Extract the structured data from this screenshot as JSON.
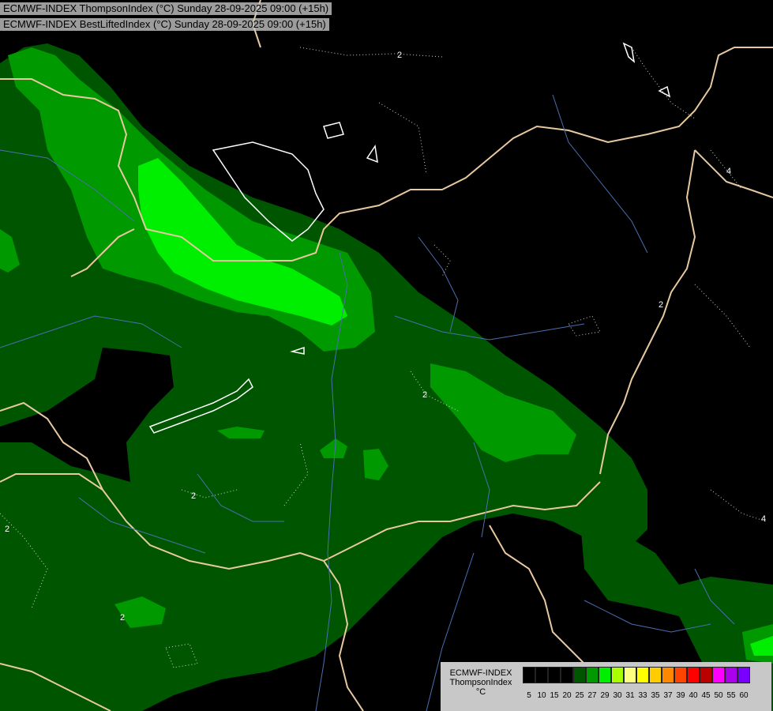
{
  "header": {
    "line1": "ECMWF-INDEX ThompsonIndex (°C) Sunday 28-09-2025 09:00 (+15h)",
    "line2": "ECMWF-INDEX BestLiftedIndex (°C) Sunday 28-09-2025 09:00 (+15h)"
  },
  "legend": {
    "model": "ECMWF-INDEX",
    "parameter": "ThompsonIndex",
    "unit": "°C",
    "classes": [
      {
        "label": "5",
        "color": "#000000"
      },
      {
        "label": "10",
        "color": "#000000"
      },
      {
        "label": "15",
        "color": "#000000"
      },
      {
        "label": "20",
        "color": "#000000"
      },
      {
        "label": "25",
        "color": "#005500"
      },
      {
        "label": "27",
        "color": "#009900"
      },
      {
        "label": "29",
        "color": "#00ee00"
      },
      {
        "label": "30",
        "color": "#aaff00"
      },
      {
        "label": "31",
        "color": "#ffff80"
      },
      {
        "label": "33",
        "color": "#ffff00"
      },
      {
        "label": "35",
        "color": "#ffcc00"
      },
      {
        "label": "37",
        "color": "#ff8800"
      },
      {
        "label": "39",
        "color": "#ff4400"
      },
      {
        "label": "40",
        "color": "#ff0000"
      },
      {
        "label": "45",
        "color": "#bb0000"
      },
      {
        "label": "50",
        "color": "#ff00ff"
      },
      {
        "label": "55",
        "color": "#aa00ee"
      },
      {
        "label": "60",
        "color": "#7700ff"
      }
    ],
    "extra_tick": "60"
  },
  "contour_labels": [
    "2",
    "2",
    "2",
    "2",
    "2",
    "2",
    "4",
    "4"
  ],
  "colors": {
    "background": "#000000",
    "green_dark": "#005500",
    "green_mid": "#009900",
    "green_bright": "#00ee00",
    "borders": "#e8c8a0",
    "rivers": "#4a6fb0",
    "lakes": "#ffffff"
  }
}
